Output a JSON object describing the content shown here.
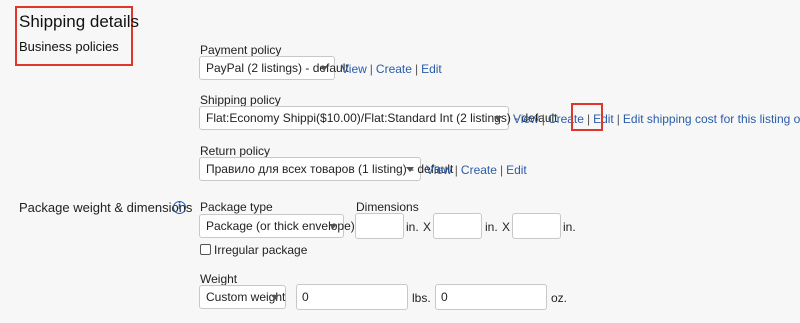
{
  "header": {
    "title": "Shipping details",
    "subtitle": "Business policies"
  },
  "payment": {
    "label": "Payment policy",
    "select_value": "PayPal (2 listings) - default",
    "link_view": "View",
    "link_create": "Create",
    "link_edit": "Edit"
  },
  "shipping": {
    "label": "Shipping policy",
    "select_value": "Flat:Economy Shippi($10.00)/Flat:Standard Int (2 listings) - default",
    "link_view": "View",
    "link_create": "Create",
    "link_edit": "Edit",
    "link_edit_cost": "Edit shipping cost for this listing only"
  },
  "return": {
    "label": "Return policy",
    "select_value": "Правило для всех товаров (1 listing) - default",
    "link_view": "View",
    "link_create": "Create",
    "link_edit": "Edit"
  },
  "package": {
    "section_label": "Package weight & dimensions",
    "info_icon": "i",
    "type_label": "Package type",
    "type_value": "Package (or thick envelope)",
    "dimensions_label": "Dimensions",
    "unit_in": "in.",
    "unit_x": "X",
    "irregular_label": "Irregular package",
    "weight_label": "Weight",
    "weight_select": "Custom weight",
    "lbs_value": "0",
    "lbs_unit": "lbs.",
    "oz_value": "0",
    "oz_unit": "oz."
  },
  "separator": "|",
  "colors": {
    "link": "#2a5ca8",
    "highlight": "#e0352b",
    "background": "#f7f7f7"
  }
}
